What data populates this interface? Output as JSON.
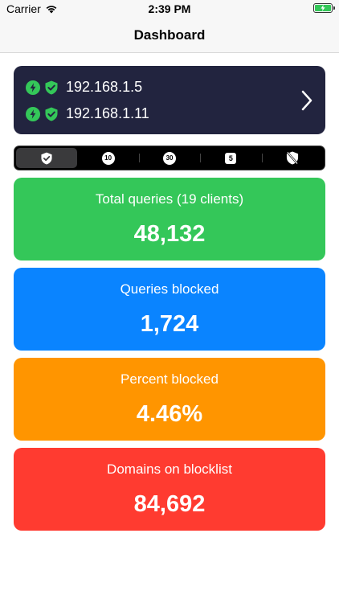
{
  "status_bar": {
    "carrier": "Carrier",
    "time": "2:39 PM"
  },
  "nav": {
    "title": "Dashboard"
  },
  "servers": [
    {
      "ip": "192.168.1.5",
      "status_color": "#34c759"
    },
    {
      "ip": "192.168.1.11",
      "status_color": "#34c759"
    }
  ],
  "segments": [
    {
      "icon": "shield-check-icon",
      "selected": true
    },
    {
      "icon": "timer-10-icon",
      "label": "10"
    },
    {
      "icon": "timer-30-icon",
      "label": "30"
    },
    {
      "icon": "timer-5-icon",
      "label": "5"
    },
    {
      "icon": "shield-off-icon"
    }
  ],
  "stats": {
    "total_queries": {
      "label": "Total queries (19 clients)",
      "value": "48,132",
      "color": "#34c759"
    },
    "queries_blocked": {
      "label": "Queries blocked",
      "value": "1,724",
      "color": "#0a84ff"
    },
    "percent_blocked": {
      "label": "Percent blocked",
      "value": "4.46%",
      "color": "#ff9500"
    },
    "domains_on_blocklist": {
      "label": "Domains on blocklist",
      "value": "84,692",
      "color": "#ff3b30"
    }
  }
}
